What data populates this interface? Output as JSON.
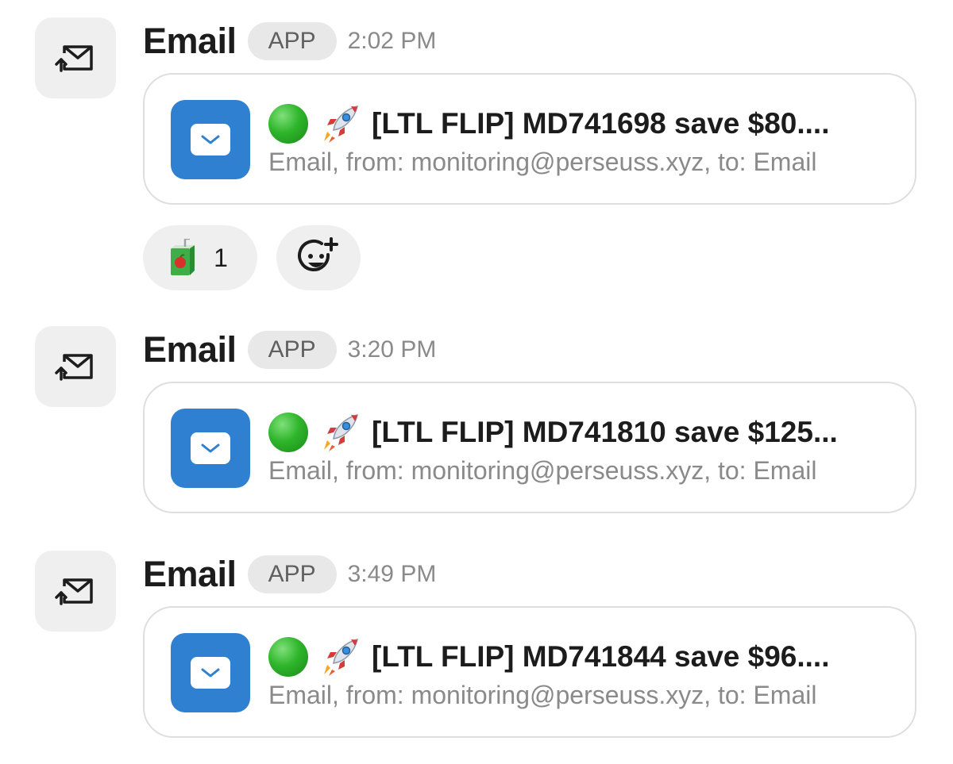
{
  "messages": [
    {
      "sender": "Email",
      "badge": "APP",
      "time": "2:02 PM",
      "title": "[LTL FLIP] MD741698 save $80....",
      "subtitle": "Email, from: monitoring@perseuss.xyz, to: Email",
      "reactions": [
        {
          "icon": "juice-box-icon",
          "count": "1"
        }
      ]
    },
    {
      "sender": "Email",
      "badge": "APP",
      "time": "3:20 PM",
      "title": "[LTL FLIP] MD741810 save $125...",
      "subtitle": "Email, from: monitoring@perseuss.xyz, to: Email"
    },
    {
      "sender": "Email",
      "badge": "APP",
      "time": "3:49 PM",
      "title": "[LTL FLIP] MD741844 save $96....",
      "subtitle": "Email, from: monitoring@perseuss.xyz, to: Email"
    }
  ],
  "icons": {
    "avatar": "forward-email-icon",
    "card": "email-app-icon",
    "status": "green-circle-emoji",
    "rocket": "rocket-emoji",
    "add_reaction": "add-reaction-icon"
  },
  "colors": {
    "card_icon_bg": "#2f80d1",
    "status_green": "#2fb52b",
    "muted_text": "#8a8a8a",
    "badge_bg": "#e8e8e8"
  }
}
